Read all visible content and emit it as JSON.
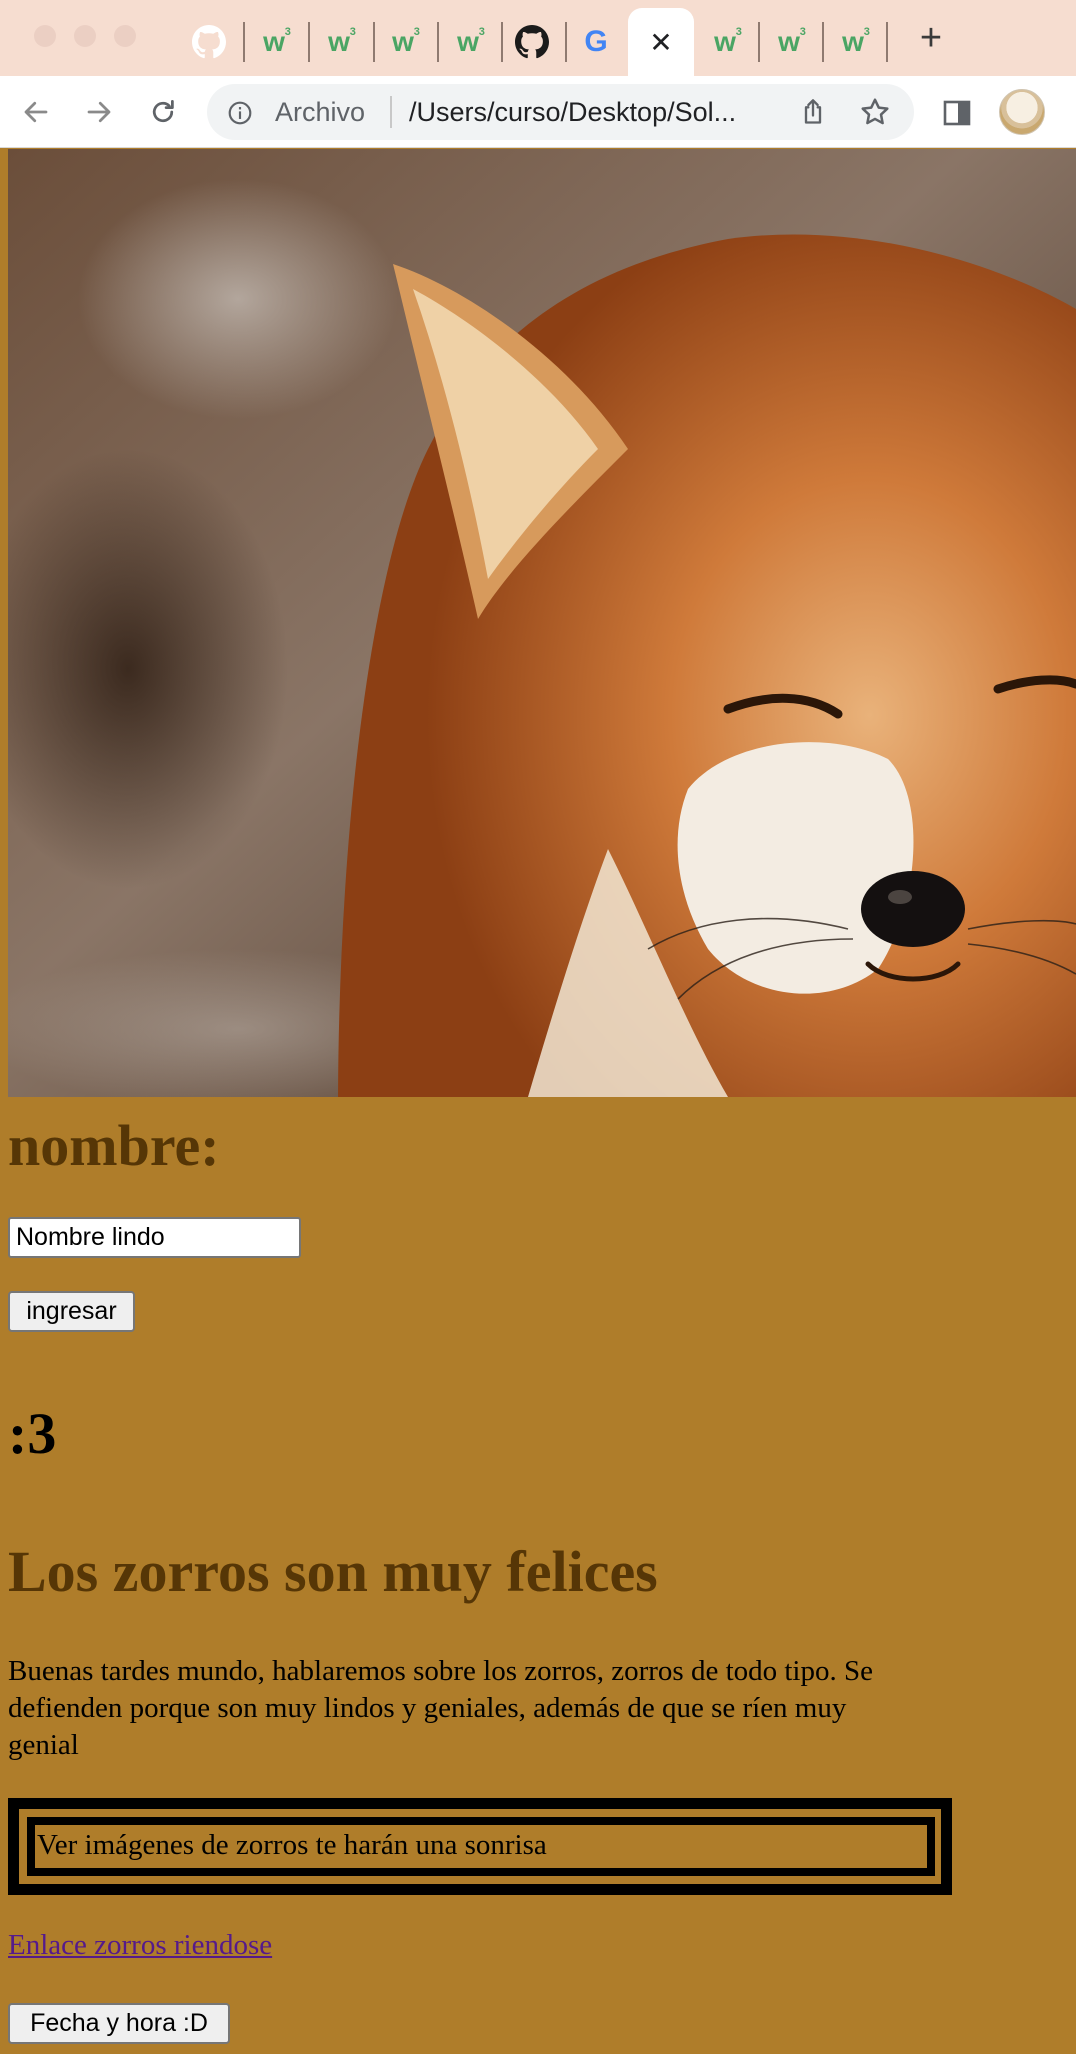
{
  "browser": {
    "tabs": [
      {
        "icon": "github-icon"
      },
      {
        "icon": "w3schools-icon",
        "glyph": "w",
        "sup": "3"
      },
      {
        "icon": "w3schools-icon",
        "glyph": "w",
        "sup": "3"
      },
      {
        "icon": "w3schools-icon",
        "glyph": "w",
        "sup": "3"
      },
      {
        "icon": "w3schools-icon",
        "glyph": "w",
        "sup": "3"
      },
      {
        "icon": "github-icon"
      },
      {
        "icon": "google-icon",
        "glyph": "G"
      },
      {
        "icon": "close-icon",
        "glyph": "✕",
        "active": true
      },
      {
        "icon": "w3schools-icon",
        "glyph": "w",
        "sup": "3"
      },
      {
        "icon": "w3schools-icon",
        "glyph": "w",
        "sup": "3"
      },
      {
        "icon": "w3schools-icon",
        "glyph": "w",
        "sup": "3"
      }
    ],
    "new_tab_glyph": "+",
    "address": {
      "security_label": "Archivo",
      "url": "/Users/curso/Desktop/Sol..."
    }
  },
  "page": {
    "name_heading": "nombre:",
    "name_input_value": "Nombre lindo",
    "submit_label": "ingresar",
    "emote_heading": ":3",
    "title": "Los zorros son muy felices",
    "intro": "Buenas tardes mundo, hablaremos sobre los zorros, zorros de todo tipo. Se defienden porque son muy lindos y geniales, además de que se ríen muy genial",
    "framed_text": "Ver imágenes de zorros te harán una sonrisa",
    "link_text": "Enlace zorros riendose",
    "datetime_button_label": "Fecha y hora :D"
  },
  "colors": {
    "page_background": "#af7d2a",
    "heading_brown": "#563606",
    "visited_link": "#551a8b",
    "tabbar": "#f6ddd0"
  }
}
